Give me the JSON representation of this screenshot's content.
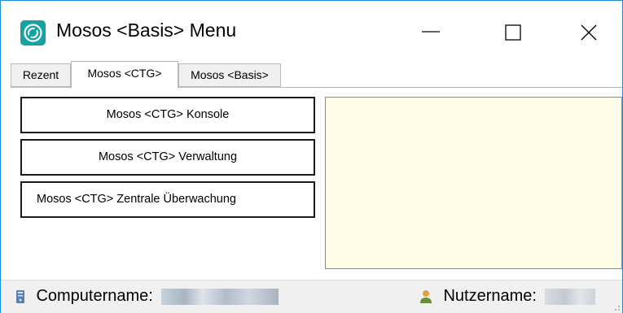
{
  "window": {
    "title": "Mosos <Basis> Menu",
    "accent": "#1e8fd6",
    "icon": "mosos-logo-icon"
  },
  "tabs": [
    {
      "label": "Rezent",
      "active": false
    },
    {
      "label": "Mosos <CTG>",
      "active": true
    },
    {
      "label": "Mosos <Basis>",
      "active": false
    }
  ],
  "menu": {
    "buttons": [
      {
        "label": "Mosos <CTG> Konsole"
      },
      {
        "label": "Mosos <CTG> Verwaltung"
      },
      {
        "label": "Mosos <CTG> Zentrale Überwachung"
      }
    ]
  },
  "info_panel": {
    "background": "#fffde6"
  },
  "status": {
    "computer_label": "Computername:",
    "computer_icon": "computer-icon",
    "user_label": "Nutzername:",
    "user_icon": "user-icon"
  }
}
